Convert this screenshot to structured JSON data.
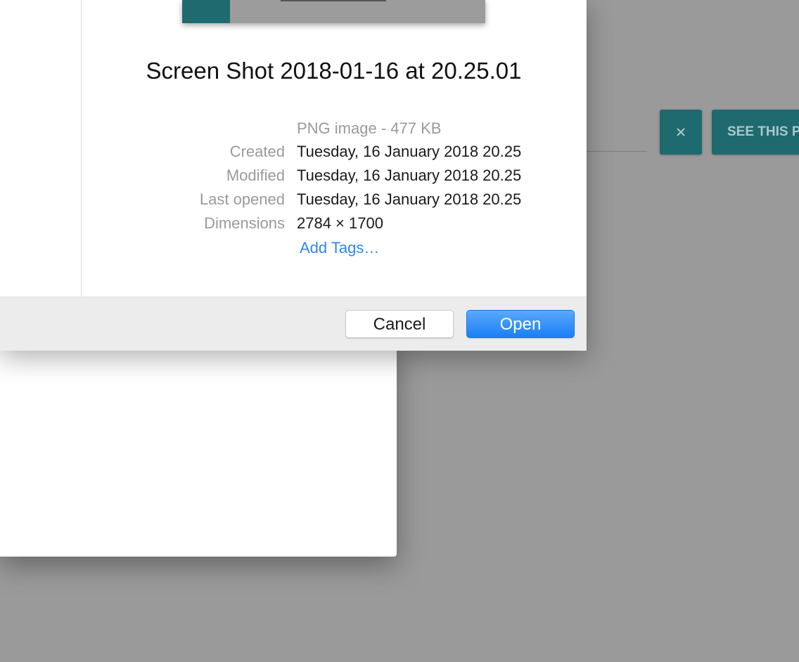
{
  "background_app": {
    "close_button_icon": "close-icon",
    "see_button_label": "SEE THIS P",
    "accent_color": "#1f6a6f"
  },
  "dialog": {
    "preview": {
      "title": "Screen Shot 2018-01-16 at 20.25.01",
      "kind": "PNG image - 477 KB",
      "fields": [
        {
          "label": "Created",
          "value": "Tuesday, 16 January 2018 20.25"
        },
        {
          "label": "Modified",
          "value": "Tuesday, 16 January 2018 20.25"
        },
        {
          "label": "Last opened",
          "value": "Tuesday, 16 January 2018 20.25"
        },
        {
          "label": "Dimensions",
          "value": "2784 × 1700"
        }
      ],
      "add_tags": "Add Tags…"
    },
    "buttons": {
      "cancel": "Cancel",
      "open": "Open"
    },
    "primary_color": "#2f86f2"
  }
}
